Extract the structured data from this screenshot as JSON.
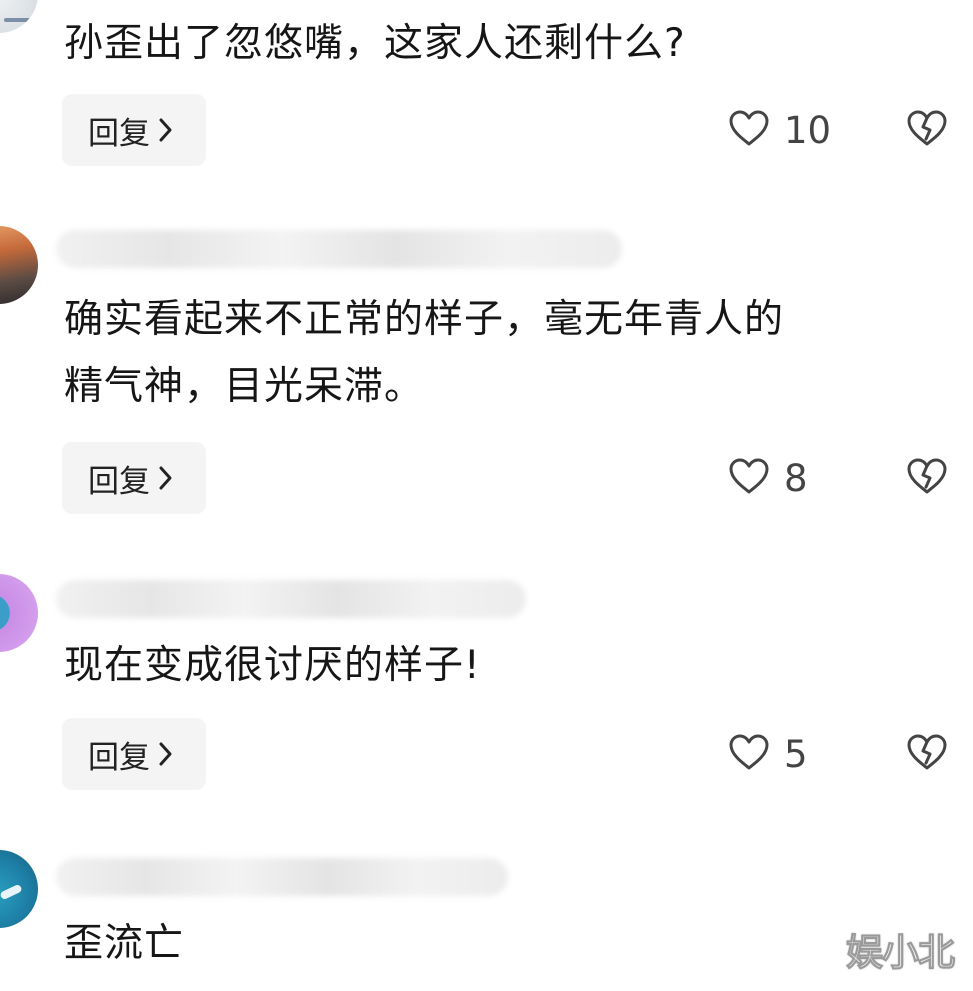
{
  "comments": [
    {
      "text": "孙歪出了忽悠嘴，这家人还剩什么?",
      "reply_label": "回复",
      "likes": "10"
    },
    {
      "text": "确实看起来不正常的样子，毫无年青人的\n精气神，目光呆滞。",
      "reply_label": "回复",
      "likes": "8"
    },
    {
      "text": "现在变成很讨厌的样子!",
      "reply_label": "回复",
      "likes": "5"
    },
    {
      "text": "歪流亡"
    }
  ],
  "icons": {
    "like": "heart-outline-icon",
    "dislike": "broken-heart-icon",
    "reply_chevron": "chevron-right-icon"
  },
  "watermark": "娱小北",
  "colors": {
    "text": "#161616",
    "button_bg": "#f4f4f4",
    "icon": "#444444"
  }
}
